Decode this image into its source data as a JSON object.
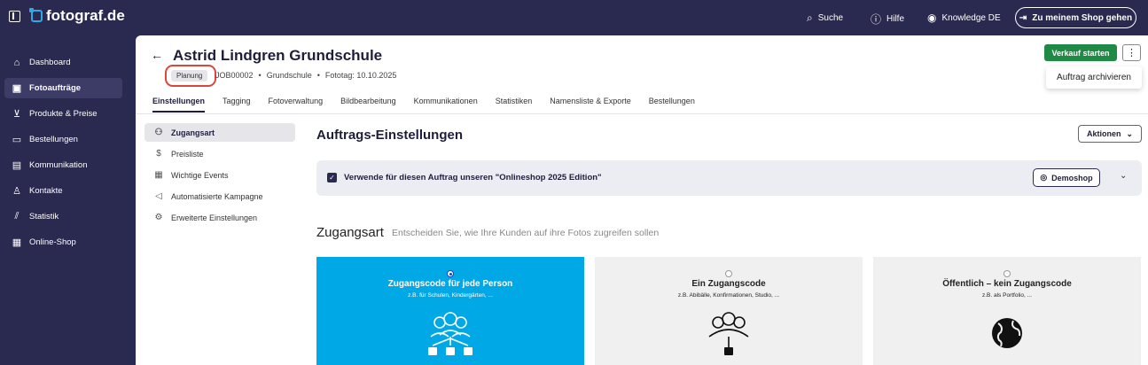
{
  "topbar": {
    "brand": "fotograf.de",
    "links": [
      {
        "label": "Suche",
        "icon": "search-icon"
      },
      {
        "label": "Hilfe",
        "icon": "info-icon"
      },
      {
        "label": "Knowledge DE",
        "icon": "user-circle-icon"
      }
    ],
    "shop_button": "Zu meinem Shop gehen"
  },
  "sidebar": {
    "items": [
      {
        "label": "Dashboard",
        "icon": "home-icon",
        "active": false
      },
      {
        "label": "Fotoaufträge",
        "icon": "image-icon",
        "active": true
      },
      {
        "label": "Produkte & Preise",
        "icon": "cart-icon",
        "active": false
      },
      {
        "label": "Bestellungen",
        "icon": "box-icon",
        "active": false
      },
      {
        "label": "Kommunikation",
        "icon": "message-icon",
        "active": false
      },
      {
        "label": "Kontakte",
        "icon": "person-icon",
        "active": false
      },
      {
        "label": "Statistik",
        "icon": "chart-icon",
        "active": false
      },
      {
        "label": "Online-Shop",
        "icon": "shop-icon",
        "active": false
      }
    ]
  },
  "header": {
    "title": "Astrid Lindgren Grundschule",
    "status": "Planung",
    "meta": [
      "JOB00002",
      "•",
      "Grundschule",
      "•",
      "Fototag: 10.10.2025"
    ],
    "start_button": "Verkauf starten",
    "more_button": "⋮",
    "menu_item": "Auftrag archivieren"
  },
  "tabs": [
    {
      "label": "Einstellungen",
      "active": true
    },
    {
      "label": "Tagging",
      "active": false
    },
    {
      "label": "Fotoverwaltung",
      "active": false
    },
    {
      "label": "Bildbearbeitung",
      "active": false
    },
    {
      "label": "Kommunikationen",
      "active": false
    },
    {
      "label": "Statistiken",
      "active": false
    },
    {
      "label": "Namensliste & Exporte",
      "active": false
    },
    {
      "label": "Bestellungen",
      "active": false
    }
  ],
  "subnav": [
    {
      "label": "Zugangsart",
      "icon": "users-key-icon",
      "active": true
    },
    {
      "label": "Preisliste",
      "icon": "dollar-circle-icon",
      "active": false
    },
    {
      "label": "Wichtige Events",
      "icon": "calendar-icon",
      "active": false
    },
    {
      "label": "Automatisierte Kampagne",
      "icon": "megaphone-icon",
      "active": false
    },
    {
      "label": "Erweiterte Einstellungen",
      "icon": "gear-icon",
      "active": false
    }
  ],
  "settings": {
    "title": "Auftrags-Einstellungen",
    "actions_button": "Aktionen",
    "shop_checkbox_label": "Verwende für diesen Auftrag unseren \"Onlineshop 2025 Edition\"",
    "shop_checked": true,
    "demo_button": "Demoshop"
  },
  "zugangsart": {
    "heading": "Zugangsart",
    "subtitle": "Entscheiden Sie, wie Ihre Kunden auf ihre Fotos zugreifen sollen",
    "options": [
      {
        "title": "Zugangscode für jede Person",
        "desc": "z.B. für Schulen, Kindergärten, ...",
        "selected": true,
        "icon": "group-locks-icon"
      },
      {
        "title": "Ein Zugangscode",
        "desc": "z.B. Abibälle, Konfirmationen, Studio, ...",
        "selected": false,
        "icon": "group-single-lock-icon"
      },
      {
        "title": "Öffentlich – kein Zugangscode",
        "desc": "z.B. als Portfolio, ...",
        "selected": false,
        "icon": "globe-icon"
      }
    ]
  },
  "colors": {
    "nav_bg": "#2a2950",
    "accent_green": "#1f8a45",
    "selected_card": "#00a8e6",
    "highlight_ring": "#d9473a"
  }
}
